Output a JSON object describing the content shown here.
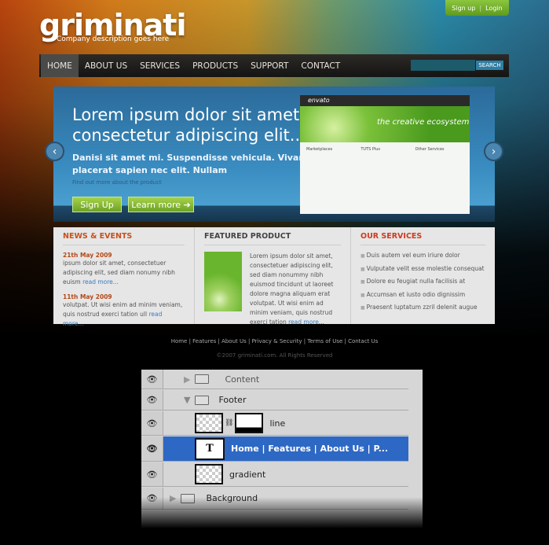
{
  "header": {
    "logo": "griminati",
    "tagline": "Company description goes here",
    "signup": "Sign up",
    "separator": "|",
    "login": "Login"
  },
  "nav": {
    "items": [
      "HOME",
      "ABOUT US",
      "SERVICES",
      "PRODUCTS",
      "SUPPORT",
      "CONTACT"
    ],
    "active": "HOME",
    "search_label": "SEARCH"
  },
  "hero": {
    "headline_1": "Lorem ipsum dolor sit amet",
    "headline_2": "consectetur adipiscing elit...",
    "sub_1": "Danisi sit amet mi. Suspendisse vehicula. Vivamus",
    "sub_2": "placerat sapien nec elit. Nullam",
    "find_out": "Find out more about the product",
    "signup_btn": "Sign Up",
    "learn_btn": "Learn more ➔",
    "screenshot": {
      "logo": "envato",
      "banner": "the creative ecosystem",
      "col1": "Marketplaces",
      "col2": "TUTS Plus",
      "col3": "Other Services"
    }
  },
  "news": {
    "title": "NEWS & EVENTS",
    "items": [
      {
        "date": "21th May 2009",
        "text": "ipsum dolor sit amet, consectetuer adipiscing elit, sed diam nonumy nibh euism",
        "more": "read more..."
      },
      {
        "date": "11th May 2009",
        "text": "volutpat. Ut wisi enim ad minim veniam, quis nostrud exerci tation ull",
        "more": "read more..."
      }
    ]
  },
  "featured": {
    "title": "FEATURED PRODUCT",
    "text": "Lorem ipsum dolor sit amet, consectetuer adipiscing elit, sed diam nonummy nibh euismod tincidunt ut laoreet dolore magna aliquam erat volutpat. Ut wisi enim ad minim veniam, quis nostrud exerci tation",
    "more": "read more..."
  },
  "services": {
    "title": "OUR SERVICES",
    "items": [
      "Duis autem vel eum iriure dolor",
      "Vulputate velit esse molestie consequat",
      "Dolore eu feugiat nulla facilisis at",
      "Accumsan et iusto odio dignissim",
      "Praesent luptatum zzril delenit augue"
    ]
  },
  "footer": {
    "links": "Home | Features | About Us | Privacy & Security | Terms of Use | Contact Us",
    "copyright": "©2007 griminati.com. All Rights Reserved"
  },
  "layers": {
    "content": "Content",
    "footer": "Footer",
    "line": "line",
    "text_layer": "Home | Features |  About Us | P...",
    "text_thumb": "T",
    "gradient": "gradient",
    "background": "Background"
  },
  "colors": {
    "accent_green": "#7bb52e",
    "hero_blue": "#3a8cc0",
    "section_orange": "#c8501c",
    "selection_blue": "#2d68c4"
  }
}
